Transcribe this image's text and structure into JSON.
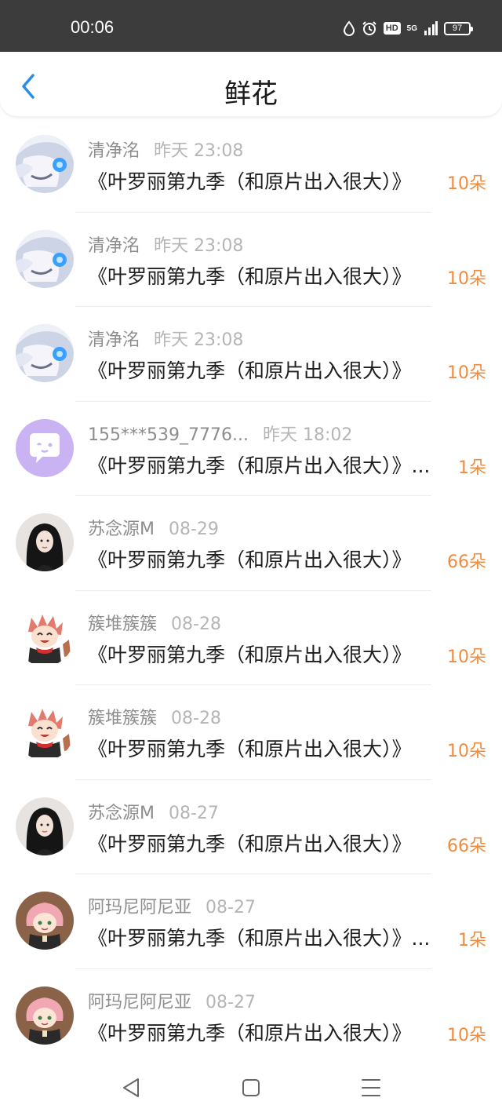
{
  "status": {
    "time": "00:06",
    "hd": "HD",
    "network": "5G",
    "battery": "97"
  },
  "header": {
    "title": "鲜花"
  },
  "items": [
    {
      "name": "清净洺",
      "time": "昨天 23:08",
      "message": "《叶罗丽第九季（和原片出入很大）》",
      "count": "10朵",
      "avatar": "anime-white-hair"
    },
    {
      "name": "清净洺",
      "time": "昨天 23:08",
      "message": "《叶罗丽第九季（和原片出入很大）》",
      "count": "10朵",
      "avatar": "anime-white-hair"
    },
    {
      "name": "清净洺",
      "time": "昨天 23:08",
      "message": "《叶罗丽第九季（和原片出入很大）》",
      "count": "10朵",
      "avatar": "anime-white-hair"
    },
    {
      "name": "155***539_7776...",
      "time": "昨天 18:02",
      "message": "《叶罗丽第九季（和原片出入很大）》...",
      "count": "1朵",
      "avatar": "purple-chat-bubble"
    },
    {
      "name": "苏念源M",
      "time": "08-29",
      "message": "《叶罗丽第九季（和原片出入很大）》",
      "count": "66朵",
      "avatar": "dark-hair-girl"
    },
    {
      "name": "簇堆簇簇",
      "time": "08-28",
      "message": "《叶罗丽第九季（和原片出入很大）》",
      "count": "10朵",
      "avatar": "red-hair-chibi"
    },
    {
      "name": "簇堆簇簇",
      "time": "08-28",
      "message": "《叶罗丽第九季（和原片出入很大）》",
      "count": "10朵",
      "avatar": "red-hair-chibi"
    },
    {
      "name": "苏念源M",
      "time": "08-27",
      "message": "《叶罗丽第九季（和原片出入很大）》",
      "count": "66朵",
      "avatar": "dark-hair-girl"
    },
    {
      "name": "阿玛尼阿尼亚",
      "time": "08-27",
      "message": "《叶罗丽第九季（和原片出入很大）》...",
      "count": "1朵",
      "avatar": "pink-hair-anya"
    },
    {
      "name": "阿玛尼阿尼亚",
      "time": "08-27",
      "message": "《叶罗丽第九季（和原片出入很大）》",
      "count": "10朵",
      "avatar": "pink-hair-anya"
    }
  ],
  "colors": {
    "accent": "#2a8ee8",
    "count": "#f08a3c",
    "status_bar": "#3c3c3c"
  }
}
